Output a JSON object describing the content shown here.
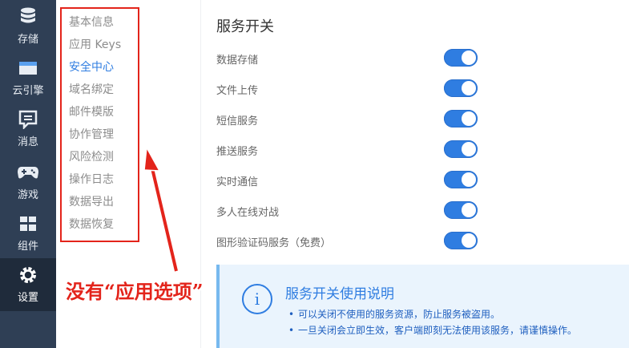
{
  "nav_rail": {
    "items": [
      {
        "label": "存储",
        "icon": "database-icon"
      },
      {
        "label": "云引擎",
        "icon": "cloud-engine-icon"
      },
      {
        "label": "消息",
        "icon": "message-icon"
      },
      {
        "label": "游戏",
        "icon": "gamepad-icon"
      },
      {
        "label": "组件",
        "icon": "component-icon"
      },
      {
        "label": "设置",
        "icon": "gear-icon",
        "active": true
      }
    ]
  },
  "submenu": {
    "items": [
      {
        "label": "基本信息"
      },
      {
        "label": "应用 Keys"
      },
      {
        "label": "安全中心",
        "active": true
      },
      {
        "label": "域名绑定"
      },
      {
        "label": "邮件模版"
      },
      {
        "label": "协作管理"
      },
      {
        "label": "风险检测"
      },
      {
        "label": "操作日志"
      },
      {
        "label": "数据导出"
      },
      {
        "label": "数据恢复"
      }
    ]
  },
  "services": {
    "title": "服务开关",
    "items": [
      {
        "label": "数据存储",
        "enabled": true
      },
      {
        "label": "文件上传",
        "enabled": true
      },
      {
        "label": "短信服务",
        "enabled": true
      },
      {
        "label": "推送服务",
        "enabled": true
      },
      {
        "label": "实时通信",
        "enabled": true
      },
      {
        "label": "多人在线对战",
        "enabled": true
      },
      {
        "label": "图形验证码服务（免费）",
        "enabled": true
      }
    ]
  },
  "notice": {
    "title": "服务开关使用说明",
    "lines": [
      "可以关闭不使用的服务资源，防止服务被盗用。",
      "一旦关闭会立即生效，客户端即刻无法使用该服务，请谨慎操作。"
    ]
  },
  "annotation": {
    "text": "没有“应用选项”",
    "color": "#e3241b"
  },
  "colors": {
    "accent": "#2f7de1",
    "rail": "#2f3f55"
  }
}
